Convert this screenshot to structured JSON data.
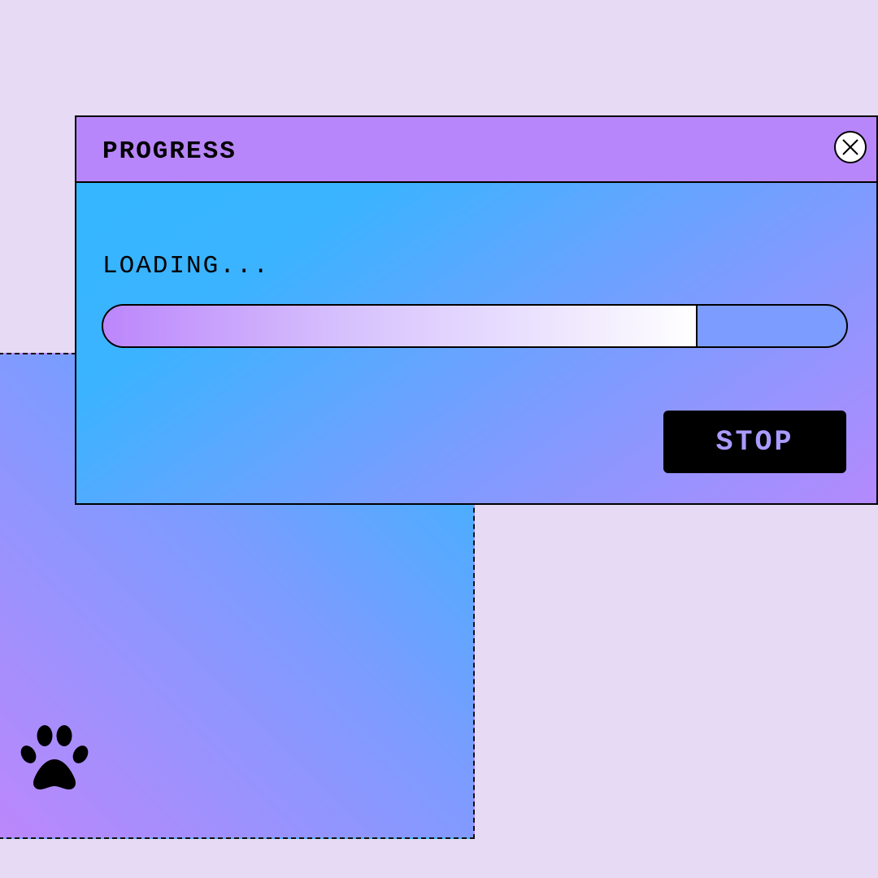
{
  "dialog": {
    "title": "PROGRESS",
    "status_text": "LOADING...",
    "progress_fraction": 0.8,
    "stop_label": "STOP",
    "close_icon": "close-icon"
  },
  "decor": {
    "icon": "paw-icon"
  },
  "colors": {
    "page_background": "#e6daf4",
    "titlebar": "#b886fb",
    "accent_blue": "#33b6ff",
    "accent_purple": "#bc87fb",
    "button_background": "#000000",
    "button_text": "#a99bff"
  }
}
